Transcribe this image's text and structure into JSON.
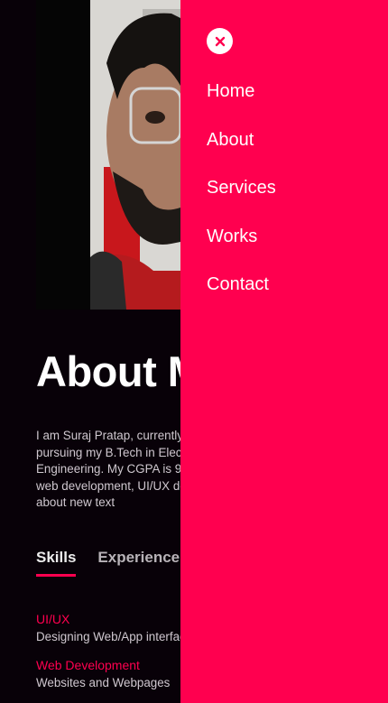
{
  "profile": {
    "photo_alt": "Profile photo"
  },
  "about": {
    "title": "About M",
    "bio": "I am Suraj Pratap, currently a student at VIT Vellore pursuing my B.Tech in Electronics and Communication Engineering. My CGPA is 9.22 and my interests lie in web development, UI/UX design and I love learning about new text"
  },
  "tabs": [
    {
      "label": "Skills",
      "active": true
    },
    {
      "label": "Experience",
      "active": false
    }
  ],
  "skills": [
    {
      "title": "UI/UX",
      "desc": "Designing Web/App interfaces"
    },
    {
      "title": "Web Development",
      "desc": "Websites and Webpages"
    }
  ],
  "menu": {
    "close_icon": "close-icon",
    "items": [
      {
        "label": "Home"
      },
      {
        "label": "About"
      },
      {
        "label": "Services"
      },
      {
        "label": "Works"
      },
      {
        "label": "Contact"
      }
    ]
  },
  "colors": {
    "background": "#080108",
    "accent": "#ff004f",
    "text": "#ffffff"
  }
}
